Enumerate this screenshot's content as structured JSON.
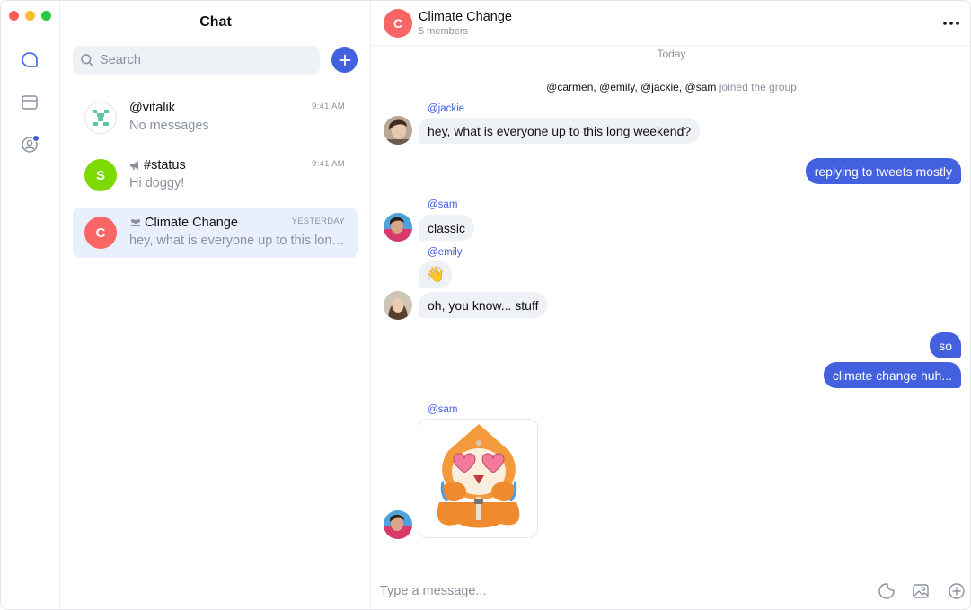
{
  "rail": {
    "items": [
      {
        "icon": "chat-bubble-icon",
        "active": true
      },
      {
        "icon": "wallet-icon"
      },
      {
        "icon": "profile-icon",
        "badge": true
      }
    ]
  },
  "list": {
    "title": "Chat",
    "search_placeholder": "Search",
    "chats": [
      {
        "name": "@vitalik",
        "preview": "No messages",
        "time": "9:41 AM",
        "avatar_icon": "robot-identicon"
      },
      {
        "name": "#status",
        "preview": "Hi doggy!",
        "time": "9:41 AM",
        "avatar_letter": "S",
        "avatar_color": "#7cda00",
        "type_icon": "megaphone-icon"
      },
      {
        "name": "Climate Change",
        "preview": "hey, what is everyone up to this long weekend?",
        "time": "YESTERDAY",
        "avatar_letter": "C",
        "avatar_color": "#fa6565",
        "type_icon": "group-icon",
        "active": true
      }
    ]
  },
  "header": {
    "avatar_letter": "C",
    "title": "Climate Change",
    "subtitle": "5 members"
  },
  "conversation": {
    "day_divider": "Today",
    "system_users": "@carmen, @emily, @jackie, @sam",
    "system_text": "joined the group",
    "messages": [
      {
        "author": "@jackie",
        "text": "hey, what is everyone up to this long weekend?"
      },
      {
        "outgoing": true,
        "text": "replying to tweets mostly"
      },
      {
        "author": "@sam",
        "text": "classic"
      },
      {
        "author": "@emily",
        "text": "👋"
      },
      {
        "text": "oh, you know... stuff"
      },
      {
        "outgoing": true,
        "text": "so"
      },
      {
        "outgoing": true,
        "text": "climate change huh..."
      },
      {
        "author": "@sam",
        "sticker": "orange-creature-heart-eyes-sticker"
      }
    ]
  },
  "composer": {
    "placeholder": "Type a message...",
    "icons": [
      "sticker-icon",
      "image-icon",
      "plus-circle-icon"
    ]
  },
  "colors": {
    "accent": "#4360df",
    "incoming_bubble": "#eef1f5",
    "muted_text": "#8a919e"
  }
}
